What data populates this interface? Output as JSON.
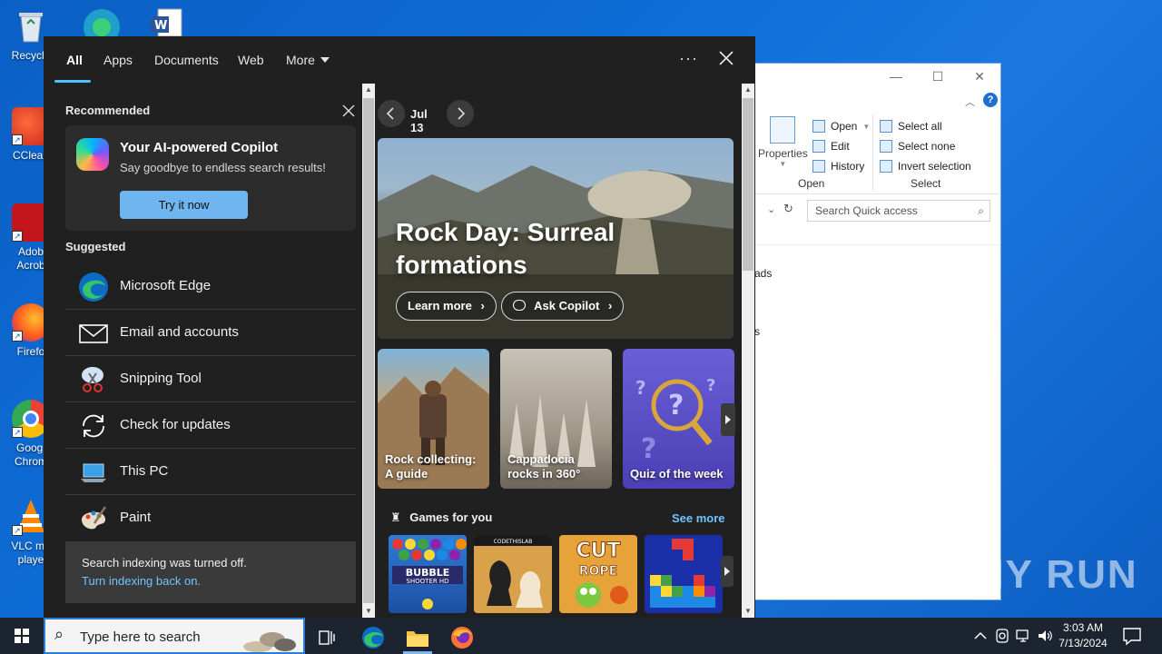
{
  "desktop": {
    "icons": [
      {
        "label": "Recycle"
      },
      {
        "label": "CClean"
      },
      {
        "label": "Adob Acrob"
      },
      {
        "label": "Firefo"
      },
      {
        "label": "Googl Chrom"
      },
      {
        "label": "VLC me playe"
      }
    ]
  },
  "explorer": {
    "ribbon": {
      "properties": "Properties",
      "open": "Open",
      "edit": "Edit",
      "history": "History",
      "open_group": "Open",
      "select_all": "Select all",
      "select_none": "Select none",
      "invert_selection": "Invert selection",
      "select_group": "Select"
    },
    "search_placeholder": "Search Quick access",
    "side_items": [
      "ads",
      "s"
    ]
  },
  "watermark": "ANY RUN",
  "search_panel": {
    "tabs": [
      "All",
      "Apps",
      "Documents",
      "Web",
      "More"
    ],
    "active_tab": "All",
    "recommended": {
      "title": "Recommended",
      "card_title": "Your AI-powered Copilot",
      "card_subtitle": "Say goodbye to endless search results!",
      "button": "Try it now"
    },
    "suggested": {
      "title": "Suggested",
      "items": [
        {
          "label": "Microsoft Edge",
          "icon": "edge-icon"
        },
        {
          "label": "Email and accounts",
          "icon": "mail-icon"
        },
        {
          "label": "Snipping Tool",
          "icon": "snipping-tool-icon"
        },
        {
          "label": "Check for updates",
          "icon": "refresh-icon"
        },
        {
          "label": "This PC",
          "icon": "computer-icon"
        },
        {
          "label": "Paint",
          "icon": "paint-icon"
        }
      ]
    },
    "indexing": {
      "message": "Search indexing was turned off.",
      "link": "Turn indexing back on."
    },
    "highlights": {
      "date": "Jul 13",
      "hero_title": "Rock Day: Surreal formations",
      "learn_more": "Learn more",
      "ask_copilot": "Ask Copilot",
      "tiles": [
        {
          "label": "Rock collecting: A guide"
        },
        {
          "label": "Cappadocia rocks in 360°"
        },
        {
          "label": "Quiz of the week"
        }
      ],
      "games_title": "Games for you",
      "see_more": "See more",
      "games": [
        "BUBBLE SHOOTER HD",
        "CODETHISLAB",
        "CUT the ROPE",
        "Blocks"
      ]
    }
  },
  "taskbar": {
    "search_placeholder": "Type here to search",
    "time": "3:03 AM",
    "date": "7/13/2024"
  },
  "colors": {
    "accent": "#4cc2ff",
    "button": "#6fb5f0",
    "panel_bg": "#202020",
    "desktop": "#0f6ed8"
  }
}
